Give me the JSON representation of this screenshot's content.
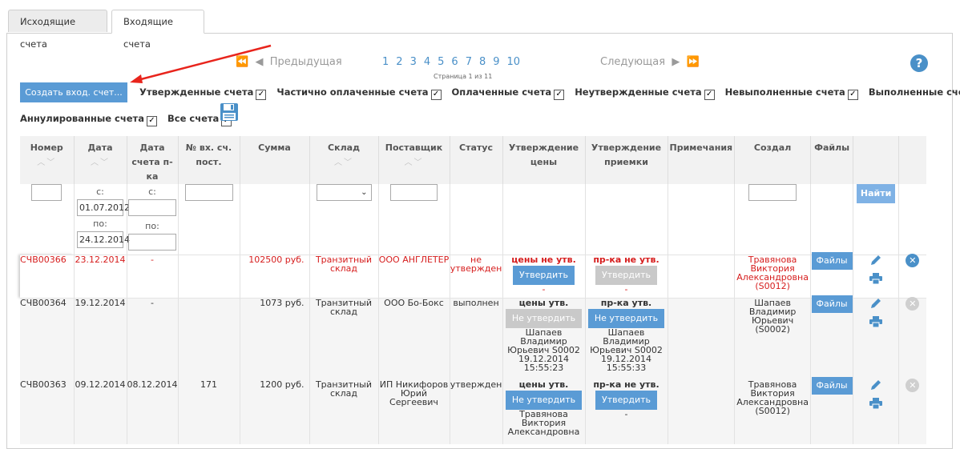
{
  "tabs": [
    {
      "label": "Исходящие счета"
    },
    {
      "label": "Входящие счета"
    }
  ],
  "pager": {
    "prev_label": "Предыдущая",
    "next_label": "Следующая",
    "pages": [
      "1",
      "2",
      "3",
      "4",
      "5",
      "6",
      "7",
      "8",
      "9",
      "10"
    ],
    "current": "1",
    "info": "Страница 1 из 11"
  },
  "help_label": "?",
  "create_button": "Создать вход. счет...",
  "filters": [
    {
      "label": "Утвержденные счета",
      "checked": true
    },
    {
      "label": "Частично оплаченные счета",
      "checked": true
    },
    {
      "label": "Оплаченные счета",
      "checked": true
    },
    {
      "label": "Неутвержденные счета",
      "checked": true
    },
    {
      "label": "Невыполненные счета",
      "checked": true
    },
    {
      "label": "Выполненные счета",
      "checked": true
    },
    {
      "label": "Аннулированные счета",
      "checked": true
    },
    {
      "label": "Все счета",
      "checked": true
    }
  ],
  "columns": {
    "number": "Номер",
    "date": "Дата",
    "supplier_date": "Дата счета п-ка",
    "in_num": "№ вх. сч. пост.",
    "sum": "Сумма",
    "warehouse": "Склад",
    "supplier": "Поставщик",
    "status": "Статус",
    "price_approval": "Утверждение цены",
    "receipt_approval": "Утверждение приемки",
    "notes": "Примечания",
    "creator": "Создал",
    "files": "Файлы"
  },
  "filter_row": {
    "from": "с:",
    "to": "по:",
    "date_from": "01.07.2012",
    "date_to": "24.12.2014",
    "find_button": "Найти"
  },
  "rows": [
    {
      "number": "СЧВ00366",
      "date": "23.12.2014",
      "supplier_date": "-",
      "in_num": "",
      "sum": "102500 руб.",
      "warehouse": "Транзитный склад",
      "supplier": "ООО АНГЛЕТЕР",
      "status": "не утвержден",
      "price_status": "цены не утв.",
      "price_button": "Утвердить",
      "price_by": "-",
      "receipt_status": "пр-ка не утв.",
      "receipt_button": "Утвердить",
      "receipt_by": "-",
      "creator": "Травянова Виктория Александровна (S0012)",
      "files_button": "Файлы"
    },
    {
      "number": "СЧВ00364",
      "date": "19.12.2014",
      "supplier_date": "-",
      "in_num": "",
      "sum": "1073 руб.",
      "warehouse": "Транзитный склад",
      "supplier": "ООО Бо-Бокс",
      "status": "выполнен",
      "price_status": "цены утв.",
      "price_button": "Не утвердить",
      "price_by": "Шапаев Владимир Юрьевич S0002 19.12.2014 15:55:23",
      "receipt_status": "пр-ка утв.",
      "receipt_button": "Не утвердить",
      "receipt_by": "Шапаев Владимир Юрьевич S0002 19.12.2014 15:55:33",
      "creator": "Шапаев Владимир Юрьевич (S0002)",
      "files_button": "Файлы"
    },
    {
      "number": "СЧВ00363",
      "date": "09.12.2014",
      "supplier_date": "08.12.2014",
      "in_num": "171",
      "sum": "1200 руб.",
      "warehouse": "Транзитный склад",
      "supplier": "ИП Никифоров Юрий Сергеевич",
      "status": "утвержден",
      "price_status": "цены утв.",
      "price_button": "Не утвердить",
      "price_by": "Травянова Виктория Александровна",
      "receipt_status": "пр-ка не утв.",
      "receipt_button": "Утвердить",
      "receipt_by": "-",
      "creator": "Травянова Виктория Александровна (S0012)",
      "files_button": "Файлы"
    }
  ]
}
